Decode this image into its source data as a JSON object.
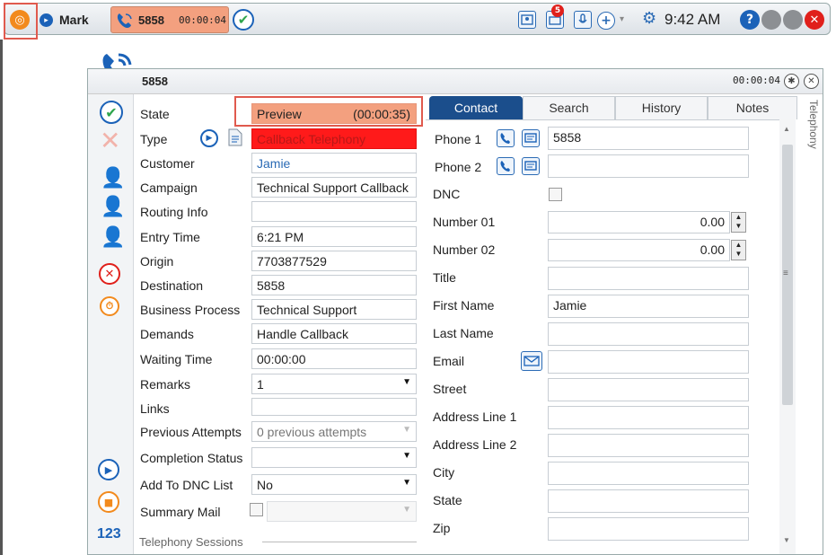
{
  "toolbar": {
    "user_name": "Mark",
    "call_number": "5858",
    "call_timer": "00:00:04",
    "notification_count": "5",
    "clock": "9:42 AM"
  },
  "window": {
    "title": "5858",
    "timer": "00:00:04",
    "side_tab": "Telephony"
  },
  "info": {
    "fields": [
      {
        "label": "State",
        "value": "Preview",
        "extra": "(00:00:35)"
      },
      {
        "label": "Type",
        "value": "Callback Telephony"
      },
      {
        "label": "Customer",
        "value": "Jamie"
      },
      {
        "label": "Campaign",
        "value": "Technical Support Callback"
      },
      {
        "label": "Routing Info",
        "value": ""
      },
      {
        "label": "Entry Time",
        "value": "6:21 PM"
      },
      {
        "label": "Origin",
        "value": "7703877529"
      },
      {
        "label": "Destination",
        "value": "5858"
      },
      {
        "label": "Business Process",
        "value": "Technical Support"
      },
      {
        "label": "Demands",
        "value": "Handle Callback"
      },
      {
        "label": "Waiting Time",
        "value": "00:00:00"
      },
      {
        "label": "Remarks",
        "value": "1"
      },
      {
        "label": "Links",
        "value": ""
      },
      {
        "label": "Previous Attempts",
        "value": "0 previous attempts"
      },
      {
        "label": "Completion Status",
        "value": ""
      },
      {
        "label": "Add To DNC List",
        "value": "No"
      },
      {
        "label": "Summary Mail",
        "value": ""
      }
    ],
    "sessions_label": "Telephony Sessions",
    "counter_label": "123"
  },
  "tabs": [
    "Contact",
    "Search",
    "History",
    "Notes"
  ],
  "contact": {
    "fields": [
      {
        "label": "Phone 1",
        "value": "5858"
      },
      {
        "label": "Phone 2",
        "value": ""
      },
      {
        "label": "DNC",
        "value": ""
      },
      {
        "label": "Number 01",
        "value": "0.00"
      },
      {
        "label": "Number 02",
        "value": "0.00"
      },
      {
        "label": "Title",
        "value": ""
      },
      {
        "label": "First Name",
        "value": "Jamie"
      },
      {
        "label": "Last Name",
        "value": ""
      },
      {
        "label": "Email",
        "value": ""
      },
      {
        "label": "Street",
        "value": ""
      },
      {
        "label": "Address Line 1",
        "value": ""
      },
      {
        "label": "Address Line 2",
        "value": ""
      },
      {
        "label": "City",
        "value": ""
      },
      {
        "label": "State",
        "value": ""
      },
      {
        "label": "Zip",
        "value": ""
      }
    ]
  },
  "colors": {
    "accent_blue": "#1b4e8c",
    "state_fill": "#f3a07f",
    "type_fill": "#ff1a1a",
    "highlight": "#e05a4e",
    "orange": "#f28a1d"
  },
  "icons": [
    "logo-icon",
    "status-icon",
    "phone-icon",
    "check-icon",
    "contact-card-icon",
    "notification-icon",
    "microphone-icon",
    "add-icon",
    "gear-icon",
    "help-icon",
    "minimize-icon",
    "restore-icon",
    "close-icon",
    "pin-icon",
    "play-icon",
    "document-icon",
    "sms-icon",
    "email-icon"
  ]
}
